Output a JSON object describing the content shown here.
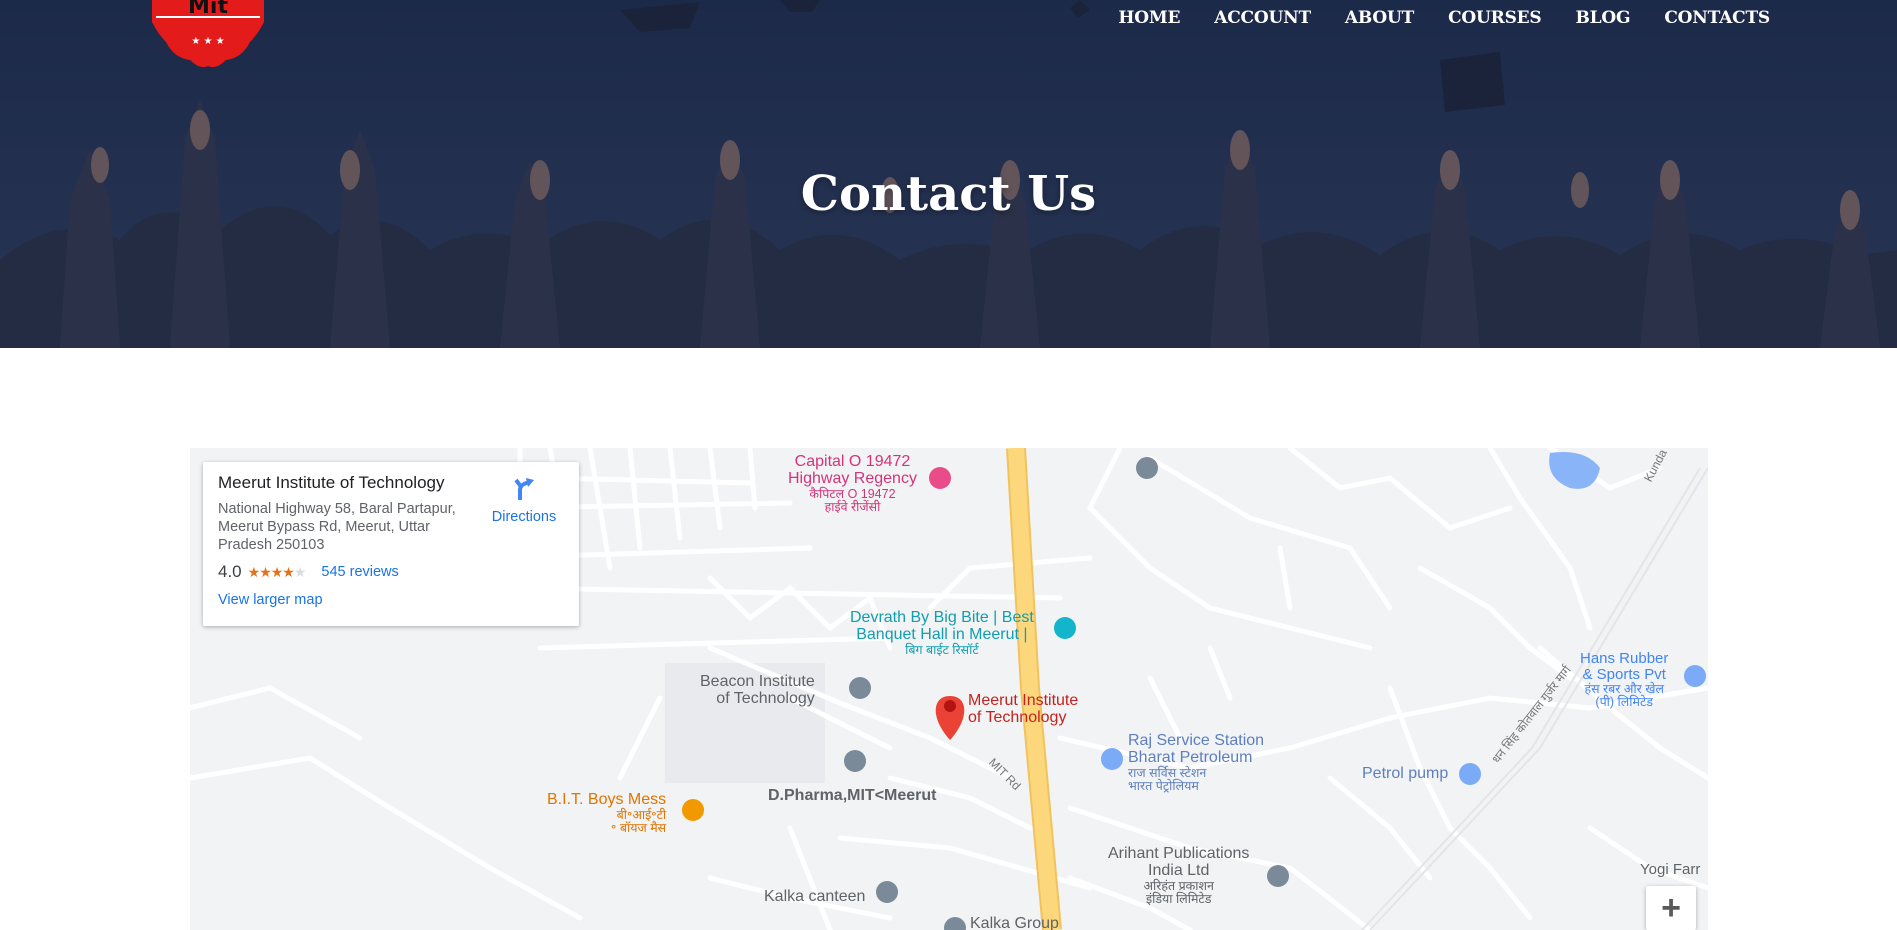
{
  "site": {
    "logo_text": "Mit",
    "nav": [
      "HOME",
      "ACCOUNT",
      "ABOUT",
      "COURSES",
      "BLOG",
      "CONTACTS"
    ],
    "hero_title": "Contact Us"
  },
  "map_card": {
    "title": "Meerut Institute of Technology",
    "address": "National Highway 58, Baral Partapur, Meerut Bypass Rd, Meerut, Uttar Pradesh 250103",
    "rating": "4.0",
    "stars_filled": 4,
    "stars_total": 5,
    "reviews": "545 reviews",
    "directions": "Directions",
    "larger_map": "View larger map"
  },
  "map": {
    "zoom_in": "+",
    "places": {
      "capital_1": "Capital O 19472",
      "capital_2": "Highway Regency",
      "capital_hi_1": "कैपिटल O 19472",
      "capital_hi_2": "हाईवे रीजेंसी",
      "devrath_1": "Devrath By Big Bite | Best",
      "devrath_2": "Banquet Hall in Meerut |",
      "devrath_hi": "बिग बाईट रिसॉर्ट",
      "beacon_1": "Beacon Institute",
      "beacon_2": "of Technology",
      "mit_1": "Meerut Institute",
      "mit_2": "of Technology",
      "raj_1": "Raj Service Station",
      "raj_2": "Bharat Petroleum",
      "raj_hi_1": "राज सर्विस स्टेशन",
      "raj_hi_2": "भारत पेट्रोलियम",
      "hans_1": "Hans Rubber",
      "hans_2": "& Sports Pvt",
      "hans_hi_1": "हंस रबर और खेल",
      "hans_hi_2": "(पी) लिमिटेड",
      "petrol": "Petrol pump",
      "dpharma": "D.Pharma,MIT<Meerut",
      "mit_rd": "MIT Rd",
      "bit_1": "B.I.T. Boys Mess",
      "bit_hi_1": "बी॰आई॰टी",
      "bit_hi_2": "॰ बॉयज मैस",
      "arihant_1": "Arihant Publications",
      "arihant_2": "India Ltd",
      "arihant_hi_1": "अरिहंत प्रकाशन",
      "arihant_hi_2": "इंडिया लिमिटेड",
      "kalka_canteen": "Kalka canteen",
      "kalka_group": "Kalka Group",
      "yogi": "Yogi Farr",
      "kunda": "Kunda Putth",
      "road_hi": "धन सिंह कोतवाल गुर्जर मार्ग"
    }
  },
  "colors": {
    "accent_link": "#1a73e8",
    "star": "#e7711b",
    "highway": "#fdd77b",
    "pin_red": "#ea4335"
  }
}
